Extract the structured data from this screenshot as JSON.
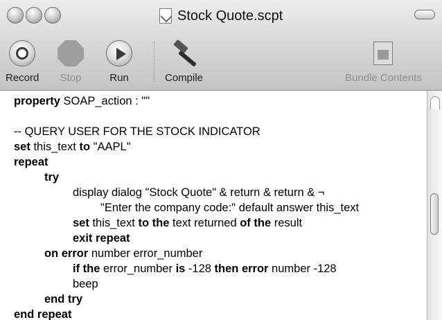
{
  "window": {
    "title": "Stock Quote.scpt"
  },
  "toolbar": {
    "record_label": "Record",
    "stop_label": "Stop",
    "run_label": "Run",
    "compile_label": "Compile",
    "bundle_label": "Bundle Contents"
  },
  "code": [
    {
      "indent": 0,
      "segs": [
        {
          "t": "property",
          "k": true
        },
        {
          "t": " SOAP_action : \"\"",
          "k": false
        }
      ]
    },
    {
      "indent": 0,
      "segs": [
        {
          "t": "",
          "k": false
        }
      ]
    },
    {
      "indent": 0,
      "segs": [
        {
          "t": "-- QUERY USER FOR THE STOCK INDICATOR",
          "k": false
        }
      ]
    },
    {
      "indent": 0,
      "segs": [
        {
          "t": "set",
          "k": true
        },
        {
          "t": " this_text ",
          "k": false
        },
        {
          "t": "to",
          "k": true
        },
        {
          "t": " \"AAPL\"",
          "k": false
        }
      ]
    },
    {
      "indent": 0,
      "segs": [
        {
          "t": "repeat",
          "k": true
        }
      ]
    },
    {
      "indent": 1,
      "segs": [
        {
          "t": "try",
          "k": true
        }
      ]
    },
    {
      "indent": 2,
      "segs": [
        {
          "t": "display dialog \"Stock Quote\" & return & return & ¬",
          "k": false
        }
      ]
    },
    {
      "indent": 3,
      "segs": [
        {
          "t": "\"Enter the company code:\" default answer this_text",
          "k": false
        }
      ]
    },
    {
      "indent": 2,
      "segs": [
        {
          "t": "set",
          "k": true
        },
        {
          "t": " this_text ",
          "k": false
        },
        {
          "t": "to the",
          "k": true
        },
        {
          "t": " text returned ",
          "k": false
        },
        {
          "t": "of the",
          "k": true
        },
        {
          "t": " result",
          "k": false
        }
      ]
    },
    {
      "indent": 2,
      "segs": [
        {
          "t": "exit repeat",
          "k": true
        }
      ]
    },
    {
      "indent": 1,
      "segs": [
        {
          "t": "on error",
          "k": true
        },
        {
          "t": " number error_number",
          "k": false
        }
      ]
    },
    {
      "indent": 2,
      "segs": [
        {
          "t": "if the",
          "k": true
        },
        {
          "t": " error_number ",
          "k": false
        },
        {
          "t": "is",
          "k": true
        },
        {
          "t": " -128 ",
          "k": false
        },
        {
          "t": "then error",
          "k": true
        },
        {
          "t": " number -128",
          "k": false
        }
      ]
    },
    {
      "indent": 2,
      "segs": [
        {
          "t": "beep",
          "k": false
        }
      ]
    },
    {
      "indent": 1,
      "segs": [
        {
          "t": "end try",
          "k": true
        }
      ]
    },
    {
      "indent": 0,
      "segs": [
        {
          "t": "end repeat",
          "k": true
        }
      ]
    }
  ]
}
